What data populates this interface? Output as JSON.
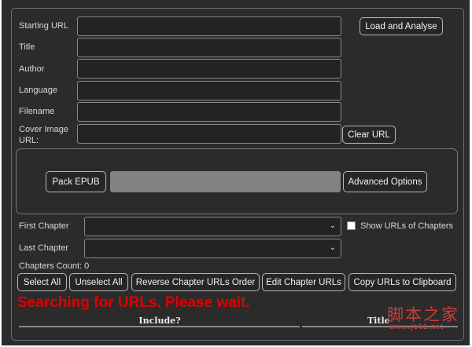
{
  "fields": {
    "starting_url": "Starting URL",
    "title": "Title",
    "author": "Author",
    "language": "Language",
    "filename": "Filename",
    "cover_line1": "Cover Image",
    "cover_line2": "URL:"
  },
  "buttons": {
    "load": "Load and Analyse",
    "clear_url": "Clear URL",
    "pack": "Pack EPUB",
    "advanced": "Advanced Options",
    "select_all": "Select All",
    "unselect_all": "Unselect All",
    "reverse": "Reverse Chapter URLs Order",
    "edit": "Edit Chapter URLs",
    "copy": "Copy URLs to Clipboard"
  },
  "progress": 0,
  "chapters": {
    "first": "First Chapter",
    "last": "Last Chapter",
    "show_urls": "Show URLs of Chapters",
    "count": "Chapters Count: 0"
  },
  "status": "Searching for URLs. Please wait.",
  "table": {
    "columns": [
      "Include?",
      "Title"
    ]
  },
  "watermark": {
    "main": "脚本之家",
    "sub": "www.jb51.net"
  }
}
